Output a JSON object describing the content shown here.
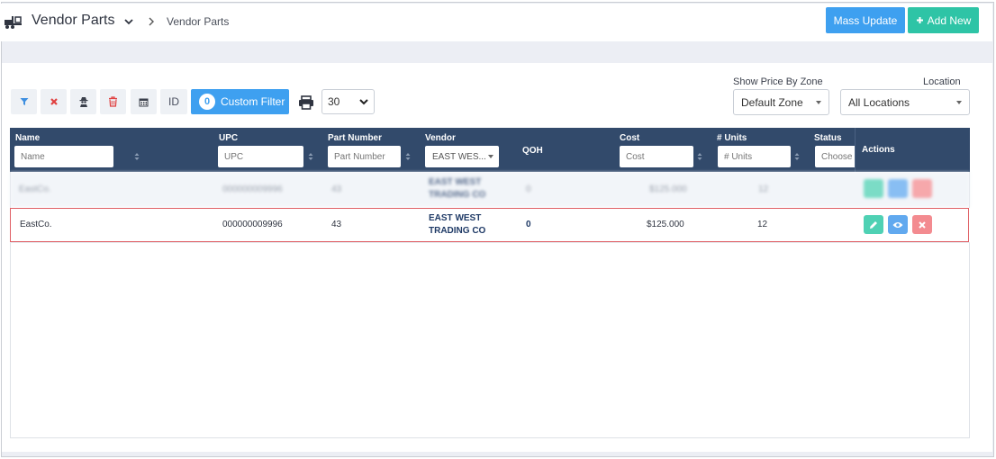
{
  "header": {
    "title": "Vendor Parts",
    "breadcrumb": "Vendor Parts",
    "mass_update_label": "Mass Update",
    "add_new_label": "Add New"
  },
  "toolbar": {
    "id_label": "ID",
    "custom_filter_count": "0",
    "custom_filter_label": "Custom Filter",
    "page_size": "30",
    "show_price_by_zone_label": "Show Price By Zone",
    "zone_value": "Default Zone",
    "location_label": "Location",
    "location_value": "All Locations",
    "icons": [
      "filter-icon",
      "clear-filter-icon",
      "user-secret-icon",
      "trash-icon",
      "calendar-icon",
      "print-icon"
    ]
  },
  "table": {
    "columns": {
      "name": "Name",
      "upc": "UPC",
      "part_number": "Part Number",
      "vendor": "Vendor",
      "qoh": "QOH",
      "cost": "Cost",
      "units": "# Units",
      "status": "Status",
      "actions": "Actions"
    },
    "filters": {
      "name_placeholder": "Name",
      "upc_placeholder": "UPC",
      "part_number_placeholder": "Part Number",
      "vendor_value": "EAST WES...",
      "cost_placeholder": "Cost",
      "units_placeholder": "# Units",
      "status_placeholder": "Choose"
    },
    "rows": [
      {
        "name": "EastCo.",
        "upc": "000000009996",
        "part_number": "43",
        "vendor_line1": "EAST WEST",
        "vendor_line2": "TRADING CO",
        "qoh": "0",
        "cost": "$125.000",
        "units": "12"
      }
    ]
  },
  "colors": {
    "header_bg": "#324a6b",
    "primary": "#3ea0f0",
    "success": "#2ec4a6",
    "edit": "#4fd1b4",
    "view": "#61a9ef",
    "delete": "#f38b90",
    "highlight_border": "#e06065"
  }
}
